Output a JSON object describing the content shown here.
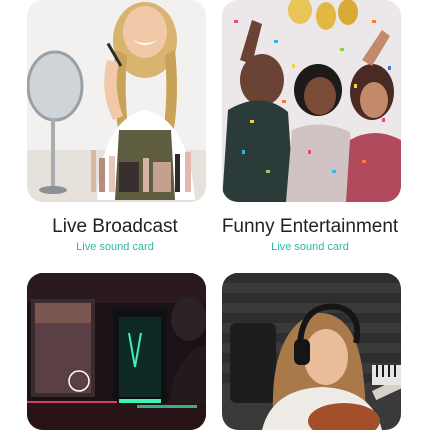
{
  "accent_color": "#2fb7a0",
  "cards": [
    {
      "title": "Live Broadcast",
      "subtitle": "Live sound card"
    },
    {
      "title": "Funny Entertainment",
      "subtitle": "Live sound card"
    }
  ]
}
